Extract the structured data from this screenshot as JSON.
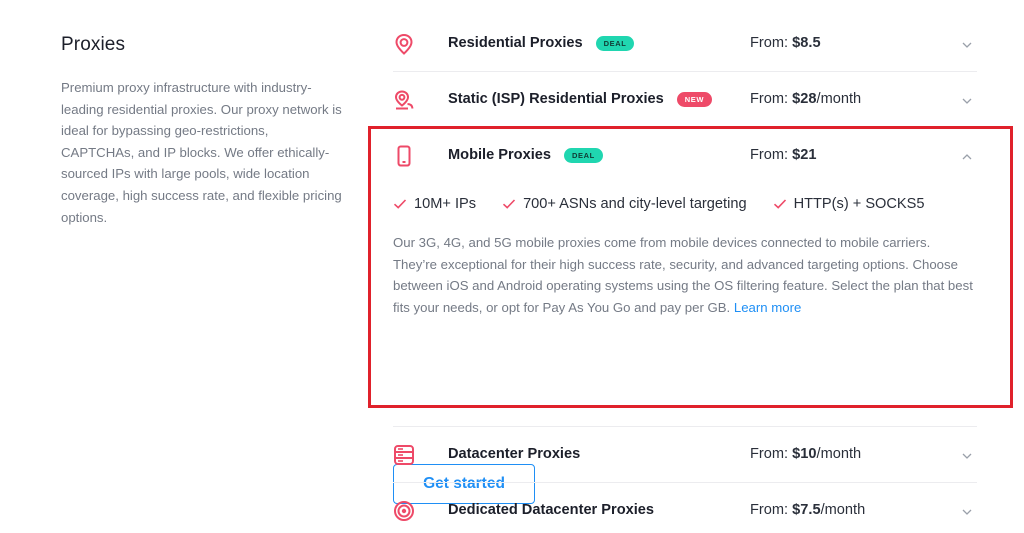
{
  "section": {
    "title": "Proxies",
    "description": "Premium proxy infrastructure with industry-leading residential proxies. Our proxy network is ideal for bypassing geo-restrictions, CAPTCHAs, and IP blocks. We offer ethically-sourced IPs with large pools, wide location coverage, high success rate, and flexible pricing options."
  },
  "products": [
    {
      "name": "Residential Proxies",
      "badge": "DEAL",
      "price_prefix": "From: ",
      "price": "$8.5",
      "price_suffix": "",
      "icon": "location-pin-icon"
    },
    {
      "name": "Static (ISP) Residential Proxies",
      "badge": "NEW",
      "price_prefix": "From: ",
      "price": "$28",
      "price_suffix": "/month",
      "icon": "location-pin-badge-icon"
    },
    {
      "name": "Mobile Proxies",
      "badge": "DEAL",
      "price_prefix": "From: ",
      "price": "$21",
      "price_suffix": "",
      "icon": "smartphone-icon"
    },
    {
      "name": "Datacenter Proxies",
      "badge": "",
      "price_prefix": "From: ",
      "price": "$10",
      "price_suffix": "/month",
      "icon": "server-icon"
    },
    {
      "name": "Dedicated Datacenter Proxies",
      "badge": "",
      "price_prefix": "From: ",
      "price": "$7.5",
      "price_suffix": "/month",
      "icon": "target-icon"
    }
  ],
  "expanded": {
    "features": [
      "10M+ IPs",
      "700+ ASNs and city-level targeting",
      "HTTP(s) + SOCKS5"
    ],
    "description": "Our 3G, 4G, and 5G mobile proxies come from mobile devices connected to mobile carriers. They’re exceptional for their high success rate, security, and advanced targeting options. Choose between iOS and Android operating systems using the OS filtering feature. Select the plan that best fits your needs, or opt for Pay As You Go and pay per GB.",
    "learn_more": "Learn more",
    "cta": "Get started"
  },
  "colors": {
    "accent": "#ee4a68",
    "link": "#1f8ff5",
    "deal_badge": "#20d6b0",
    "new_badge": "#ee4a68",
    "highlight_border": "#e0212b"
  }
}
